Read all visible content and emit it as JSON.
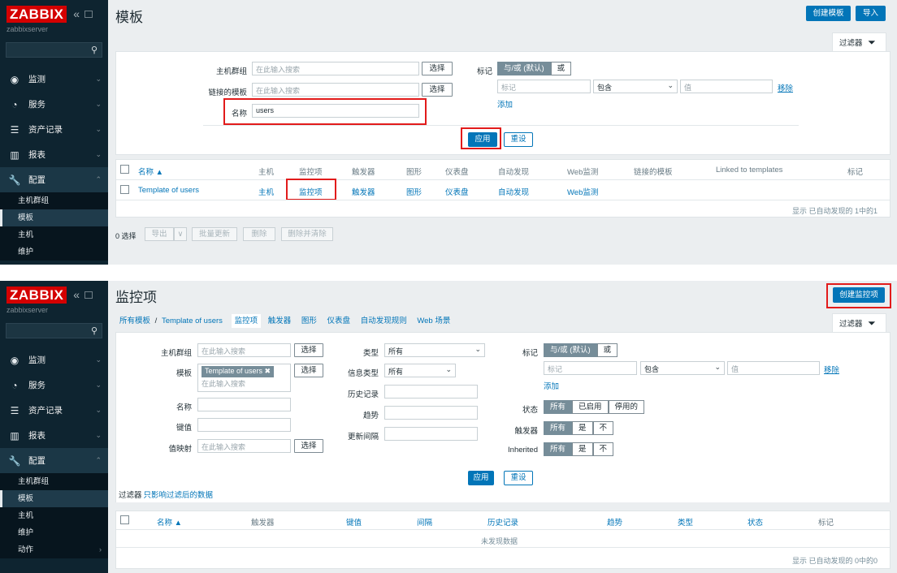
{
  "sidebar": {
    "logo": "ZABBIX",
    "collapse_glyph": "«",
    "server": "zabbixserver",
    "menu": [
      {
        "label": "监测",
        "icon": "eye-icon"
      },
      {
        "label": "服务",
        "icon": "clock-icon"
      },
      {
        "label": "资产记录",
        "icon": "list-icon"
      },
      {
        "label": "报表",
        "icon": "bar-chart-icon"
      },
      {
        "label": "配置",
        "icon": "wrench-icon"
      }
    ],
    "sub_p1": [
      "主机群组",
      "模板",
      "主机",
      "维护"
    ],
    "sub_p2": [
      "主机群组",
      "模板",
      "主机",
      "维护",
      "动作"
    ]
  },
  "p1": {
    "title": "模板",
    "btn_create": "创建模板",
    "btn_import": "导入",
    "filter_tab": "过滤器",
    "f_hostgroup": "主机群组",
    "f_linked": "链接的模板",
    "f_name": "名称",
    "ph_search": "在此输入搜索",
    "name_value": "users",
    "select_btn": "选择",
    "tags_label": "标记",
    "and_or": "与/或 (默认)",
    "or": "或",
    "tag_ph": "标记",
    "contains": "包含",
    "value_ph": "值",
    "remove": "移除",
    "add": "添加",
    "apply": "应用",
    "reset": "重设",
    "cols": [
      "名称 ▲",
      "主机",
      "监控项",
      "触发器",
      "图形",
      "仪表盘",
      "自动发现",
      "Web监测",
      "链接的模板",
      "Linked to templates",
      "标记"
    ],
    "row": [
      "Template of users",
      "主机",
      "监控项",
      "触发器",
      "图形",
      "仪表盘",
      "自动发现",
      "Web监测"
    ],
    "footer": "显示 已自动发现的 1中的1",
    "selected": "0 选择",
    "actions": [
      "导出",
      "∨",
      "批量更新",
      "删除",
      "删除并清除"
    ]
  },
  "p2": {
    "title": "监控项",
    "btn_create": "创建监控项",
    "breadcrumb": {
      "all": "所有模板",
      "sep": "/",
      "tpl": "Template of users"
    },
    "tabs": [
      "监控项",
      "触发器",
      "图形",
      "仪表盘",
      "自动发现规则",
      "Web 场景"
    ],
    "filter_tab": "过滤器",
    "f_hostgroup": "主机群组",
    "f_template": "模板",
    "f_name": "名称",
    "f_key": "键值",
    "f_valuemap": "值映射",
    "ph_search": "在此输入搜索",
    "select_btn": "选择",
    "template_tag": "Template of users ✖",
    "f_type": "类型",
    "type_val": "所有",
    "f_infotype": "信息类型",
    "infotype_val": "所有",
    "f_history": "历史记录",
    "f_trends": "趋势",
    "f_interval": "更新间隔",
    "tags_label": "标记",
    "and_or": "与/或 (默认)",
    "or": "或",
    "tag_ph": "标记",
    "contains": "包含",
    "value_ph": "值",
    "remove": "移除",
    "add": "添加",
    "f_status": "状态",
    "status_opts": [
      "所有",
      "已启用",
      "停用的"
    ],
    "f_triggers": "触发器",
    "f_inherited": "Inherited",
    "yn_opts": [
      "所有",
      "是",
      "不"
    ],
    "apply": "应用",
    "reset": "重设",
    "filter_note_a": "过滤器",
    "filter_note_b": "只影响过滤后的数据",
    "cols": [
      "名称 ▲",
      "触发器",
      "键值",
      "间隔",
      "历史记录",
      "趋势",
      "类型",
      "状态",
      "标记"
    ],
    "nodata": "未发现数据",
    "footer": "显示 已自动发现的 0中的0"
  }
}
